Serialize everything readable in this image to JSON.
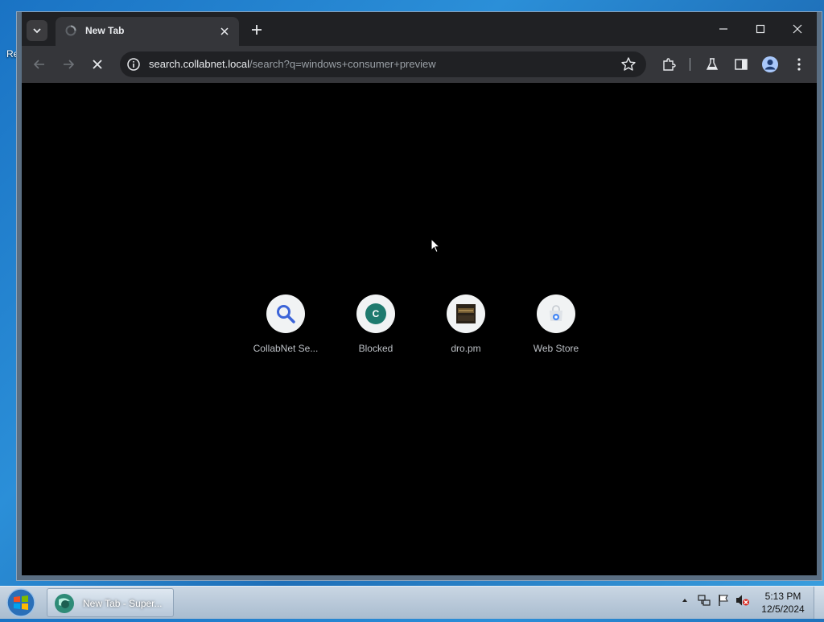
{
  "desktop": {
    "label": "Re"
  },
  "browser": {
    "tab": {
      "title": "New Tab"
    },
    "omnibox": {
      "host": "search.collabnet.local",
      "path": "/search?q=windows+consumer+preview"
    }
  },
  "shortcuts": [
    {
      "label": "CollabNet Se...",
      "icon": "search-icon"
    },
    {
      "label": "Blocked",
      "icon": "letter-c-icon",
      "letter": "C"
    },
    {
      "label": "dro.pm",
      "icon": "site-thumbnail-icon"
    },
    {
      "label": "Web Store",
      "icon": "web-store-icon"
    }
  ],
  "taskbar": {
    "task": {
      "label": "New Tab - Super..."
    },
    "clock": {
      "time": "5:13 PM",
      "date": "12/5/2024"
    }
  },
  "colors": {
    "tabstrip": "#202124",
    "toolbar": "#35363a",
    "content": "#000000",
    "accent_search": "#3c64d8",
    "blocked_badge": "#1e7a6e"
  }
}
